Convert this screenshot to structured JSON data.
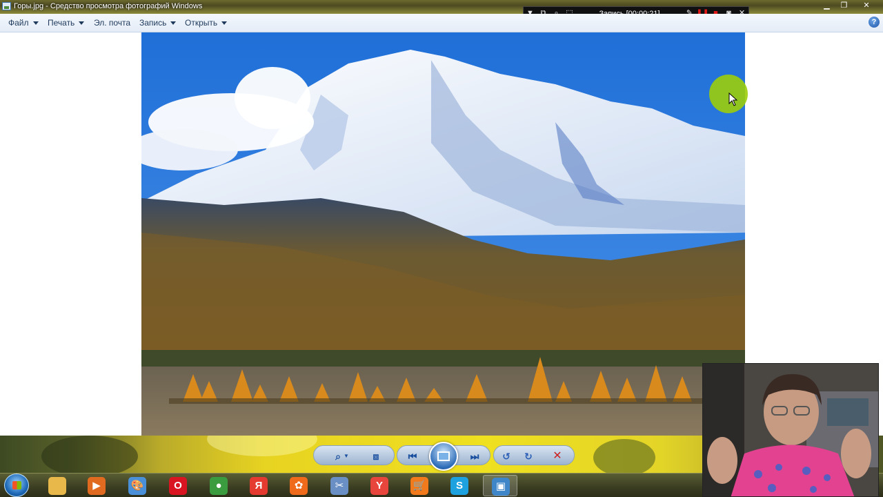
{
  "window": {
    "title": "Горы.jpg - Средство просмотра фотографий Windows",
    "controls": [
      "minimize-icon",
      "restore-icon",
      "close-icon"
    ]
  },
  "recorder": {
    "label": "Запись [00:00:21]",
    "icons": [
      "dropdown-icon",
      "windows-icon",
      "zoom-icon",
      "region-icon",
      "pen-icon",
      "pause-icon",
      "stop-icon",
      "camera-icon",
      "close-icon"
    ]
  },
  "menu": {
    "file": "Файл",
    "print": "Печать",
    "email": "Эл. почта",
    "burn": "Запись",
    "open": "Открыть",
    "help_icon": "help-icon"
  },
  "photo": {
    "subject": "mountain-landscape",
    "sky_color": "#2f7fe0"
  },
  "controls": {
    "icons": [
      "zoom-icon",
      "fit-window-icon",
      "previous-icon",
      "slideshow-icon",
      "next-icon",
      "rotate-left-icon",
      "rotate-right-icon",
      "delete-icon"
    ]
  },
  "taskbar": {
    "apps": [
      {
        "name": "explorer",
        "icon": "folder-icon",
        "glyph": "",
        "color": "#e8b84a"
      },
      {
        "name": "media-player",
        "icon": "media-player-icon",
        "glyph": "▶",
        "color": "#e06a20"
      },
      {
        "name": "paint",
        "icon": "paint-icon",
        "glyph": "🎨",
        "color": "#4a90d9"
      },
      {
        "name": "opera",
        "icon": "opera-icon",
        "glyph": "O",
        "color": "#d91522"
      },
      {
        "name": "chrome",
        "icon": "chrome-icon",
        "glyph": "●",
        "color": "#3b9c3f"
      },
      {
        "name": "yandex",
        "icon": "yandex-icon",
        "glyph": "Я",
        "color": "#e43a2f"
      },
      {
        "name": "media",
        "icon": "film-reel-icon",
        "glyph": "✿",
        "color": "#ef6a1b"
      },
      {
        "name": "snipping",
        "icon": "scissors-icon",
        "glyph": "✂",
        "color": "#6a8fc4"
      },
      {
        "name": "yandex-browser",
        "icon": "yandex-browser-icon",
        "glyph": "Y",
        "color": "#e8453c"
      },
      {
        "name": "shop",
        "icon": "cart-icon",
        "glyph": "🛒",
        "color": "#f07a1c"
      },
      {
        "name": "skype",
        "icon": "skype-icon",
        "glyph": "S",
        "color": "#1ea1df"
      },
      {
        "name": "photo-viewer",
        "icon": "photo-viewer-icon",
        "glyph": "▣",
        "color": "#3e86c8"
      }
    ]
  }
}
